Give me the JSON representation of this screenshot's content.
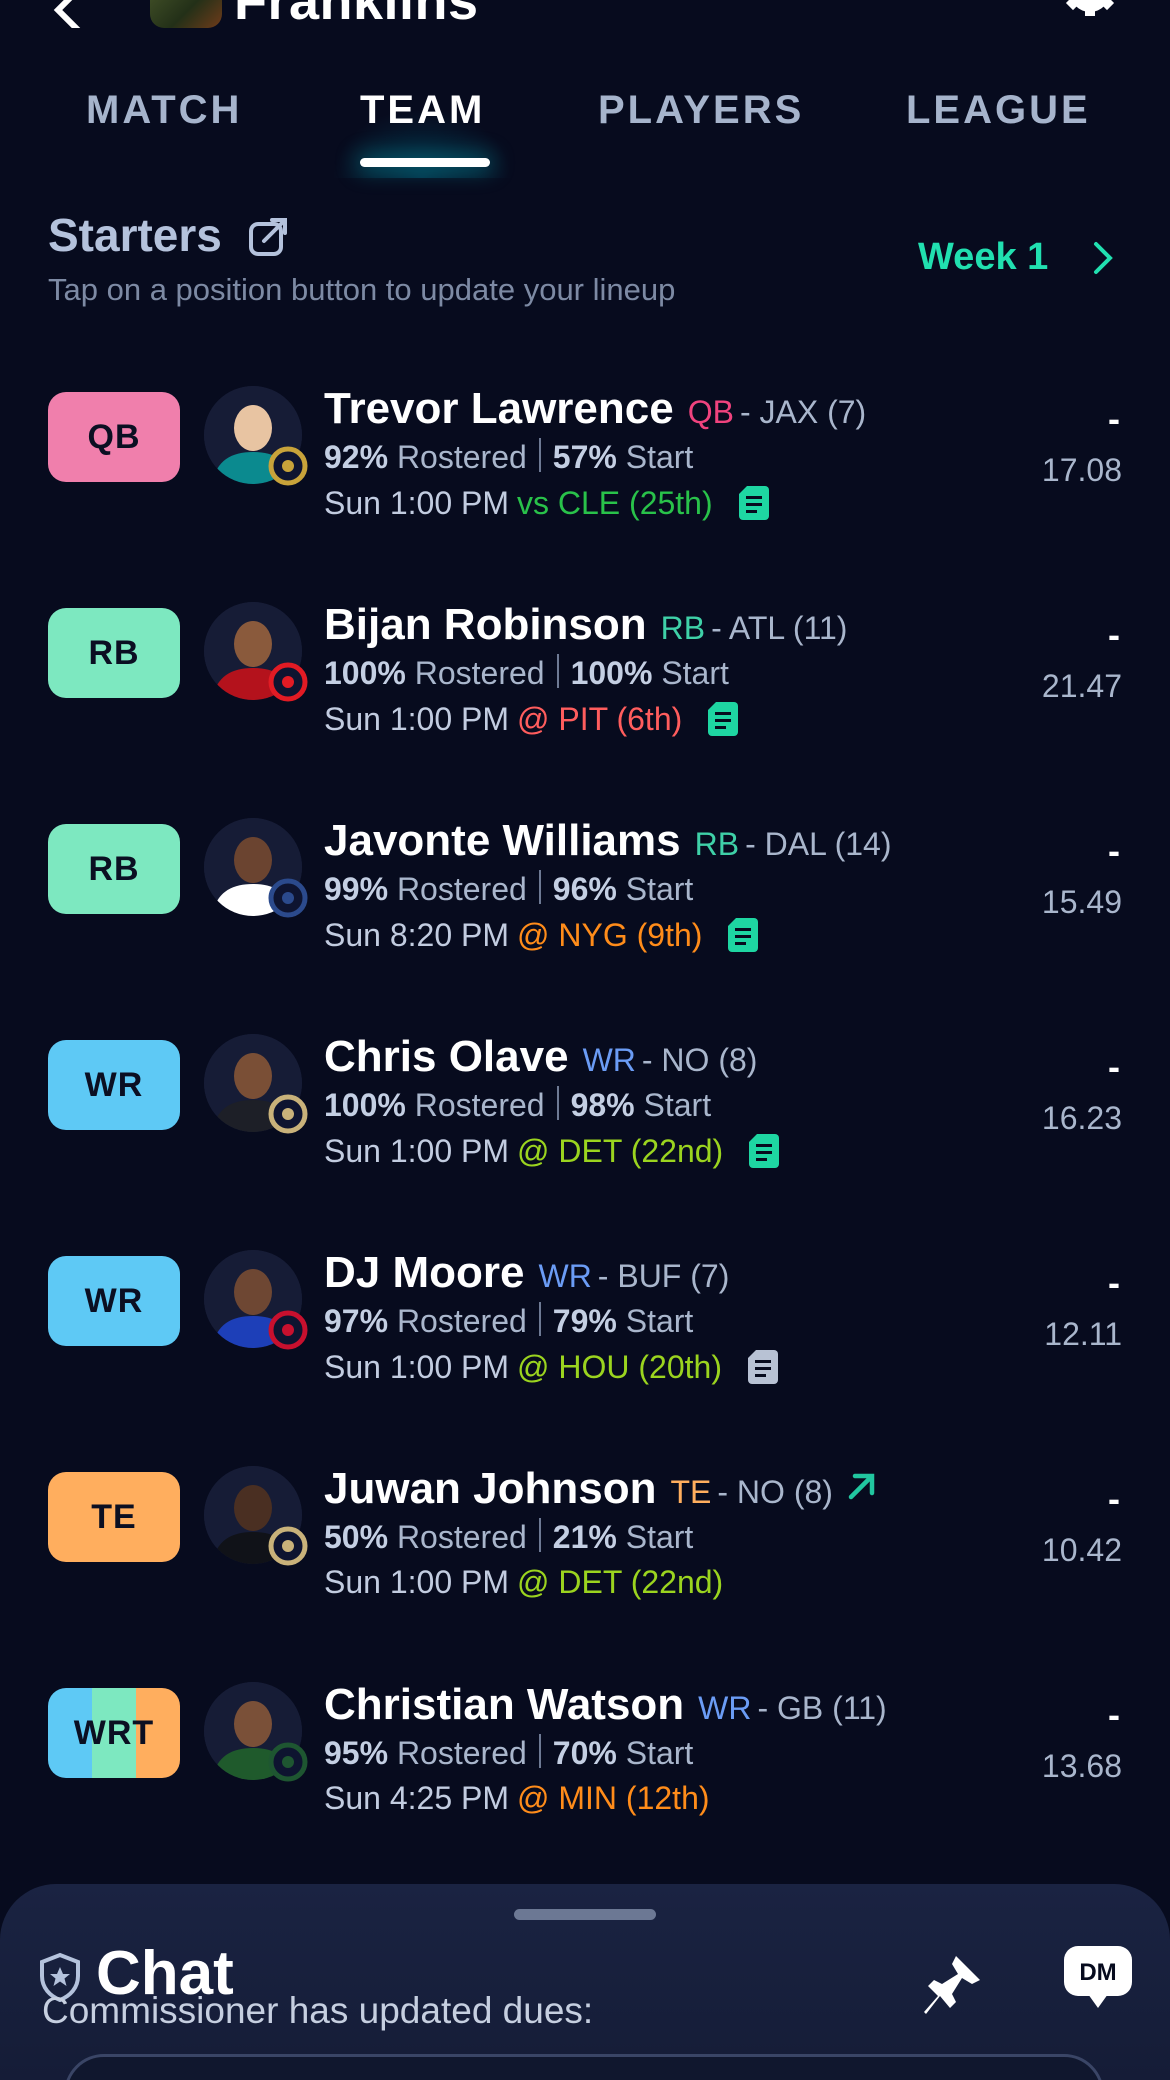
{
  "header": {
    "team_name": "Franklins"
  },
  "tabs": [
    {
      "label": "MATCH",
      "active": false
    },
    {
      "label": "TEAM",
      "active": true
    },
    {
      "label": "PLAYERS",
      "active": false
    },
    {
      "label": "LEAGUE",
      "active": false
    }
  ],
  "starters": {
    "title": "Starters",
    "subtitle": "Tap on a position button to update your lineup",
    "week_label": "Week 1"
  },
  "colors": {
    "accent": "#21e0b0",
    "QB": "#f07fac",
    "RB": "#7de8c0",
    "WR": "#5ec9f5",
    "TE": "#ffae5e",
    "pos_text_QB": "#f0437e",
    "pos_text_RB": "#3fd1a8",
    "pos_text_WR": "#6b9cf5",
    "pos_text_TE": "#ffae5e",
    "opp_good": "#29c24a",
    "opp_bad": "#ff5d5d",
    "opp_mid": "#ff8c1a",
    "opp_lime": "#9bd41f"
  },
  "players": [
    {
      "slot": "QB",
      "name": "Trevor Lawrence",
      "pos": "QB",
      "team_info": "- JAX (7)",
      "rostered_pct": "92%",
      "rostered_label": "Rostered",
      "start_pct": "57%",
      "start_label": "Start",
      "game_time": "Sun 1:00 PM",
      "opponent": "vs CLE (25th)",
      "opp_color": "opp_good",
      "proj_dash": "-",
      "proj_points": "17.08",
      "note": "note-green",
      "team_logo": "jaguars-logo"
    },
    {
      "slot": "RB",
      "name": "Bijan Robinson",
      "pos": "RB",
      "team_info": "- ATL (11)",
      "rostered_pct": "100%",
      "rostered_label": "Rostered",
      "start_pct": "100%",
      "start_label": "Start",
      "game_time": "Sun 1:00 PM",
      "opponent": "@ PIT (6th)",
      "opp_color": "opp_bad",
      "proj_dash": "-",
      "proj_points": "21.47",
      "note": "note-green",
      "team_logo": "falcons-logo"
    },
    {
      "slot": "RB",
      "name": "Javonte Williams",
      "pos": "RB",
      "team_info": "- DAL (14)",
      "rostered_pct": "99%",
      "rostered_label": "Rostered",
      "start_pct": "96%",
      "start_label": "Start",
      "game_time": "Sun 8:20 PM",
      "opponent": "@ NYG (9th)",
      "opp_color": "opp_mid",
      "proj_dash": "-",
      "proj_points": "15.49",
      "note": "note-green",
      "team_logo": "cowboys-logo"
    },
    {
      "slot": "WR",
      "name": "Chris Olave",
      "pos": "WR",
      "team_info": "- NO (8)",
      "rostered_pct": "100%",
      "rostered_label": "Rostered",
      "start_pct": "98%",
      "start_label": "Start",
      "game_time": "Sun 1:00 PM",
      "opponent": "@ DET (22nd)",
      "opp_color": "opp_lime",
      "proj_dash": "-",
      "proj_points": "16.23",
      "note": "note-green",
      "team_logo": "saints-logo"
    },
    {
      "slot": "WR",
      "name": "DJ Moore",
      "pos": "WR",
      "team_info": "- BUF (7)",
      "rostered_pct": "97%",
      "rostered_label": "Rostered",
      "start_pct": "79%",
      "start_label": "Start",
      "game_time": "Sun 1:00 PM",
      "opponent": "@ HOU (20th)",
      "opp_color": "opp_lime",
      "proj_dash": "-",
      "proj_points": "12.11",
      "note": "note-gray",
      "team_logo": "bills-logo"
    },
    {
      "slot": "TE",
      "name": "Juwan Johnson",
      "pos": "TE",
      "team_info": "- NO (8)",
      "rostered_pct": "50%",
      "rostered_label": "Rostered",
      "start_pct": "21%",
      "start_label": "Start",
      "game_time": "Sun 1:00 PM",
      "opponent": "@ DET (22nd)",
      "opp_color": "opp_lime",
      "proj_dash": "-",
      "proj_points": "10.42",
      "note": "trend-up",
      "team_logo": "saints-logo"
    },
    {
      "slot": "WRT",
      "name": "Christian Watson",
      "pos": "WR",
      "team_info": "- GB (11)",
      "rostered_pct": "95%",
      "rostered_label": "Rostered",
      "start_pct": "70%",
      "start_label": "Start",
      "game_time": "Sun 4:25 PM",
      "opponent": "@ MIN (12th)",
      "opp_color": "opp_mid",
      "proj_dash": "-",
      "proj_points": "13.68",
      "note": "none",
      "team_logo": "packers-logo"
    }
  ],
  "chat": {
    "title": "Chat",
    "preview": "Commissioner has updated dues:",
    "dm_label": "DM"
  }
}
